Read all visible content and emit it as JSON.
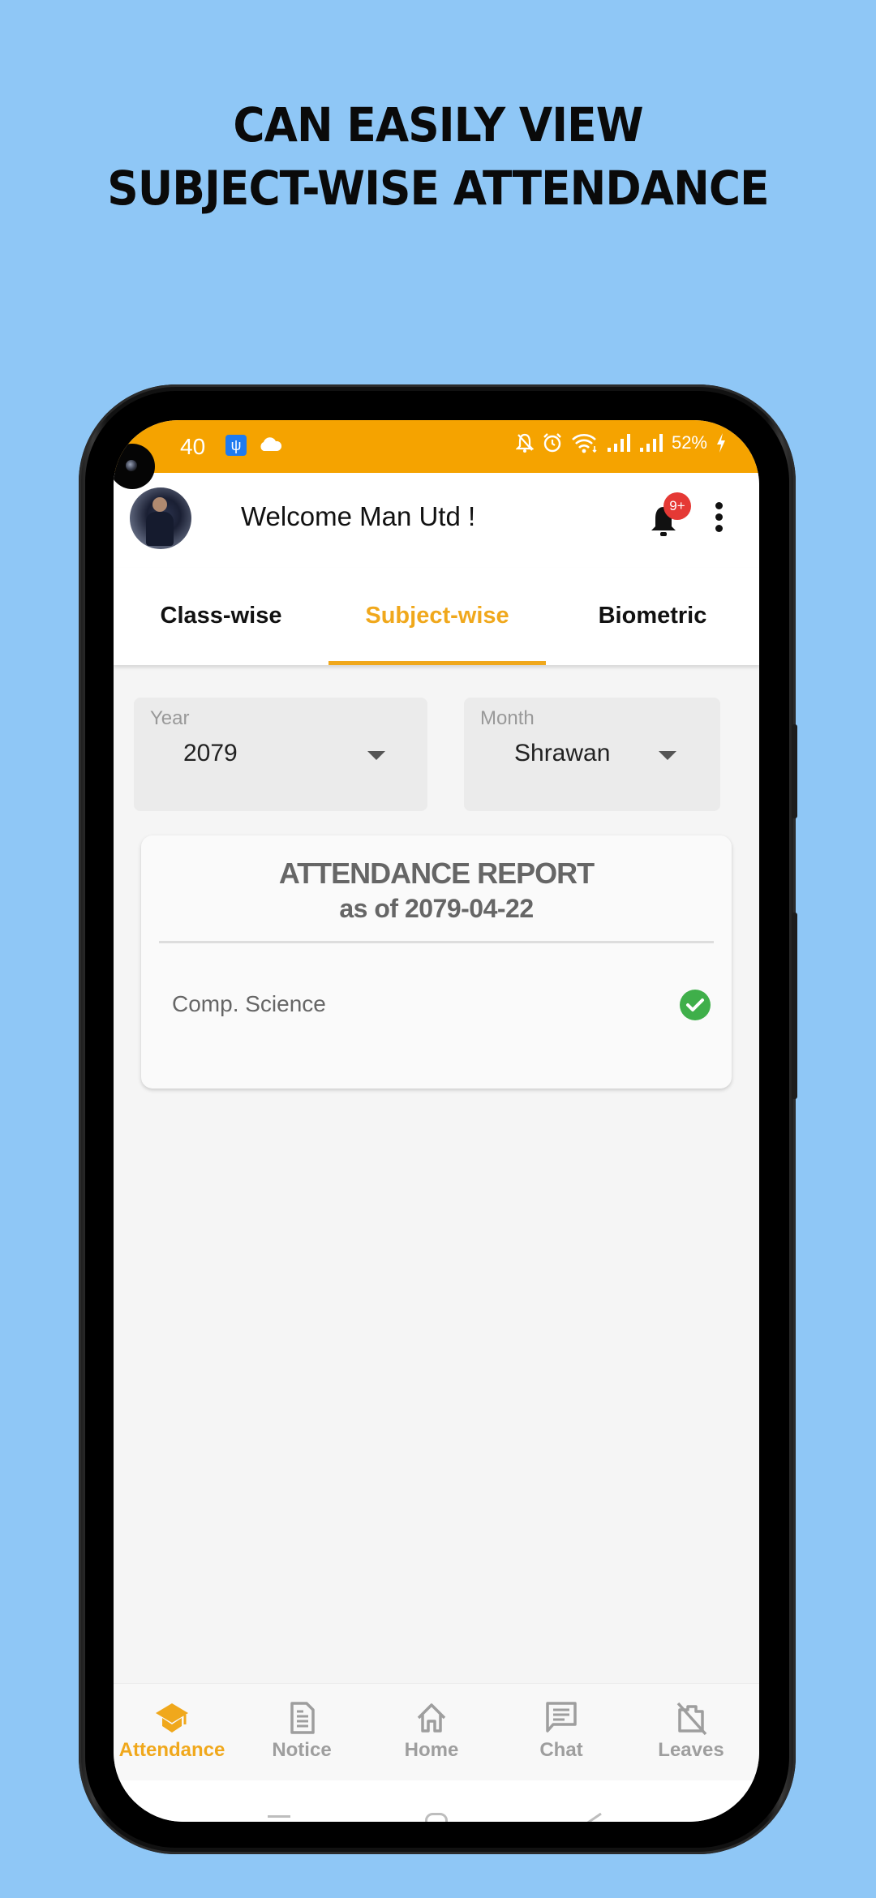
{
  "promo": {
    "headline_line1": "CAN EASILY VIEW",
    "headline_line2": "SUBJECT-WISE ATTENDANCE"
  },
  "status_bar": {
    "time": "40",
    "battery": "52%",
    "icons": [
      "usb-icon",
      "cloud-icon",
      "mute-icon",
      "alarm-icon",
      "wifi-icon",
      "signal-icon",
      "signal-icon",
      "charging-icon"
    ]
  },
  "header": {
    "welcome": "Welcome Man Utd !",
    "notification_badge": "9+"
  },
  "tabs": [
    {
      "label": "Class-wise",
      "active": false
    },
    {
      "label": "Subject-wise",
      "active": true
    },
    {
      "label": "Biometric",
      "active": false
    }
  ],
  "filters": {
    "year": {
      "label": "Year",
      "value": "2079"
    },
    "month": {
      "label": "Month",
      "value": "Shrawan"
    }
  },
  "report": {
    "title": "ATTENDANCE REPORT",
    "subtitle": "as of 2079-04-22",
    "subjects": [
      {
        "name": "Comp. Science",
        "status": "present",
        "status_icon": "check-circle-icon"
      }
    ]
  },
  "bottom_nav": [
    {
      "label": "Attendance",
      "icon": "graduation-cap-icon",
      "active": true
    },
    {
      "label": "Notice",
      "icon": "document-icon",
      "active": false
    },
    {
      "label": "Home",
      "icon": "home-icon",
      "active": false
    },
    {
      "label": "Chat",
      "icon": "chat-icon",
      "active": false
    },
    {
      "label": "Leaves",
      "icon": "leaves-off-icon",
      "active": false
    }
  ],
  "colors": {
    "accent": "#F0A81C",
    "status_bar": "#F5A300",
    "background": "#8FC7F6",
    "badge": "#E53935",
    "present": "#3FAF4A"
  }
}
